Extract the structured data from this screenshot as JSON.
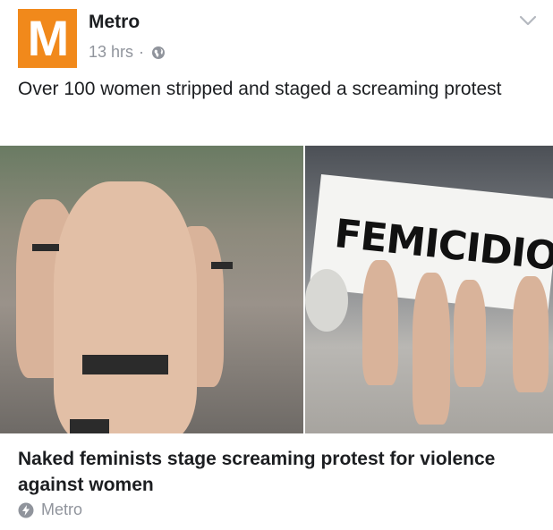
{
  "header": {
    "logo_letter": "M",
    "page_name": "Metro",
    "timestamp": "13 hrs",
    "separator": "·",
    "privacy_icon": "globe-icon",
    "menu_icon": "chevron-down-icon"
  },
  "post": {
    "text": "Over 100 women stripped and staged a screaming protest"
  },
  "media": {
    "banner_text": "FEMICIDIO ES"
  },
  "link": {
    "title": "Naked feminists stage screaming protest for violence against women",
    "source": "Metro",
    "source_icon": "instant-article-bolt-icon"
  },
  "colors": {
    "brand_orange": "#f1891b",
    "meta_gray": "#90949c",
    "text_dark": "#1c1e21"
  }
}
